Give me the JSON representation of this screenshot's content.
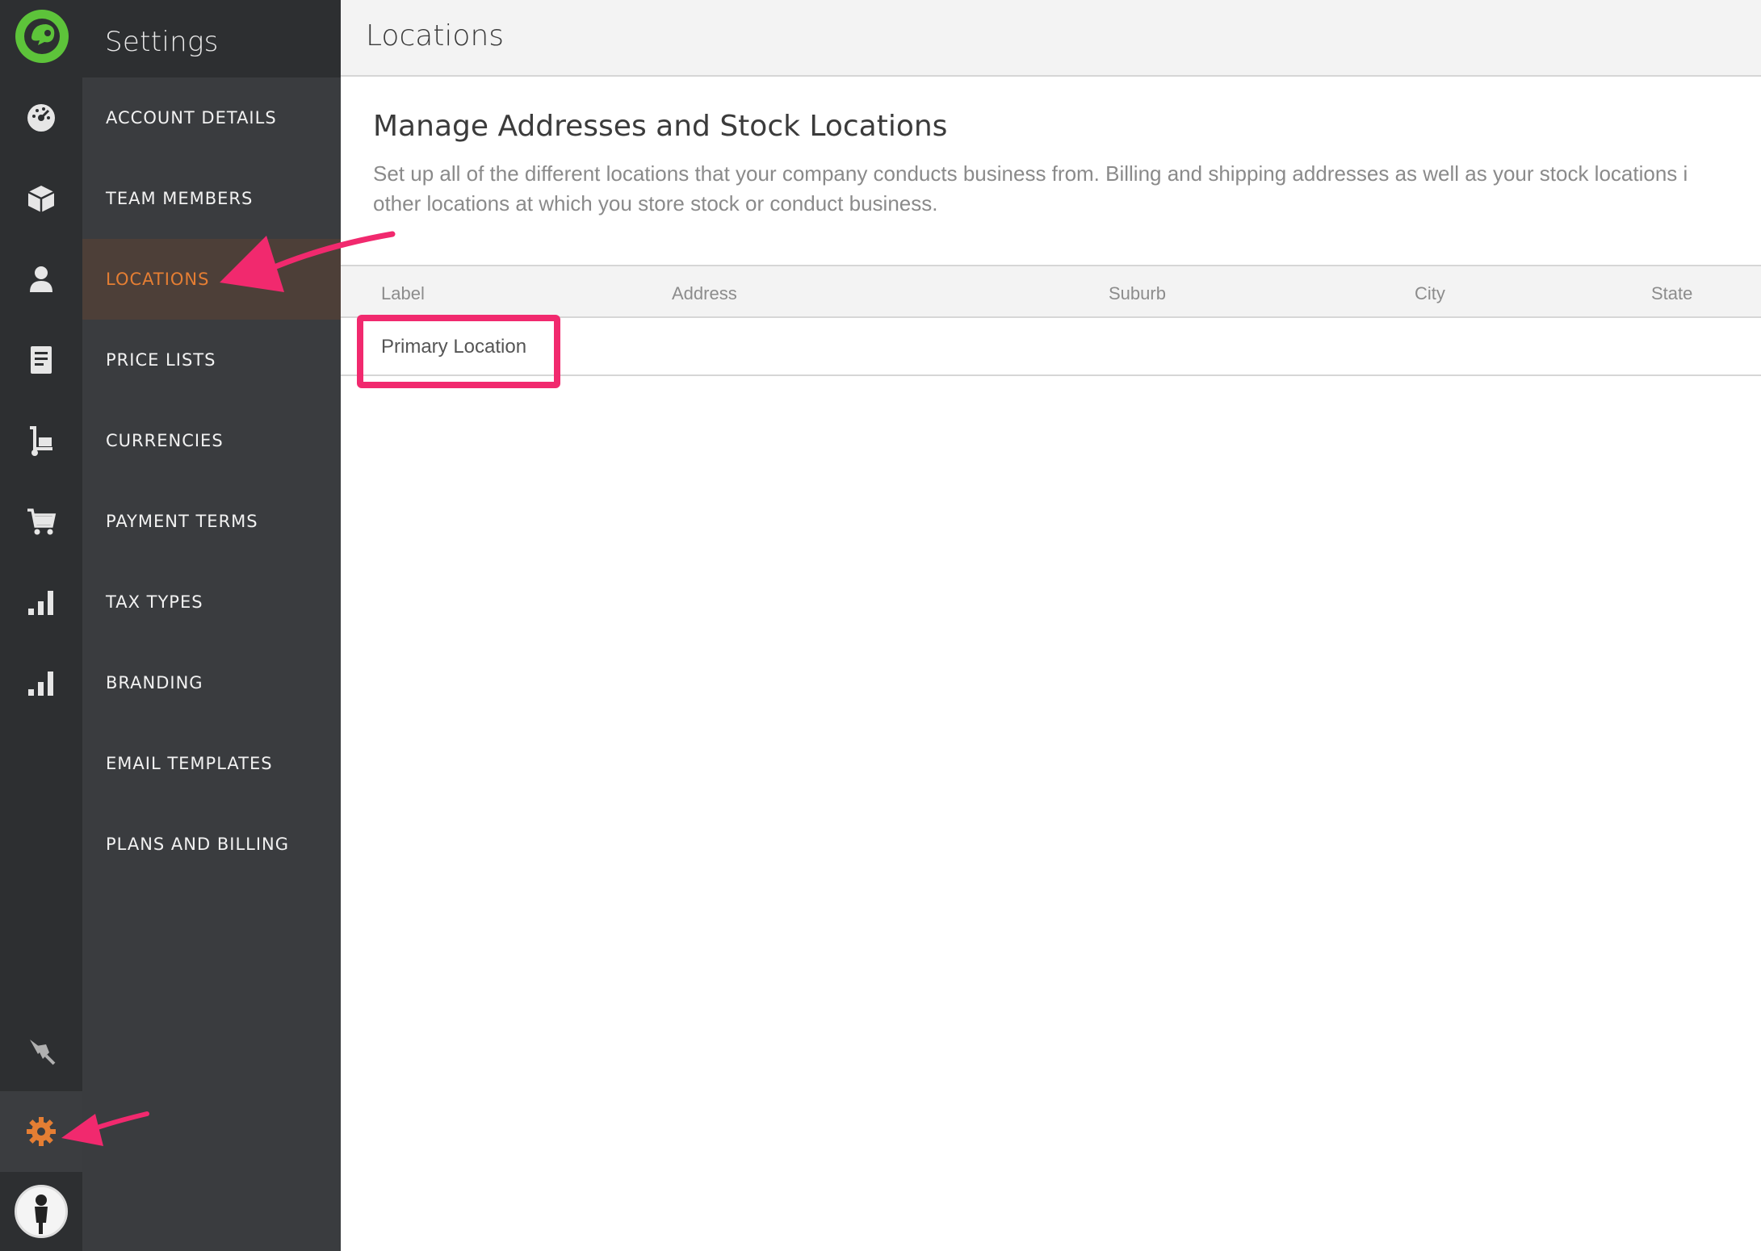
{
  "sidebar": {
    "title": "Settings",
    "items": [
      {
        "label": "ACCOUNT DETAILS",
        "active": false
      },
      {
        "label": "TEAM MEMBERS",
        "active": false
      },
      {
        "label": "LOCATIONS",
        "active": true
      },
      {
        "label": "PRICE LISTS",
        "active": false
      },
      {
        "label": "CURRENCIES",
        "active": false
      },
      {
        "label": "PAYMENT TERMS",
        "active": false
      },
      {
        "label": "TAX TYPES",
        "active": false
      },
      {
        "label": "BRANDING",
        "active": false
      },
      {
        "label": "EMAIL TEMPLATES",
        "active": false
      },
      {
        "label": "PLANS AND BILLING",
        "active": false
      }
    ]
  },
  "rail": {
    "icons": [
      "dashboard-icon",
      "box-icon",
      "person-icon",
      "document-icon",
      "trolley-icon",
      "cart-icon",
      "bar-chart-icon",
      "bar-chart-icon",
      "plug-icon",
      "gear-icon"
    ]
  },
  "main": {
    "page_title": "Locations",
    "section_title": "Manage Addresses and Stock Locations",
    "section_desc_1": "Set up all of the different locations that your company conducts business from. Billing and shipping addresses as well as your stock locations i",
    "section_desc_2": "other locations at which you store stock or conduct business.",
    "table": {
      "columns": [
        "Label",
        "Address",
        "Suburb",
        "City",
        "State"
      ],
      "rows": [
        {
          "label": "Primary Location"
        }
      ]
    }
  },
  "colors": {
    "accent": "#e57e33",
    "annotation": "#f1296e",
    "rail_bg": "#2d2f31",
    "sidebar_bg": "#3a3c3f",
    "logo_green": "#5dc33a"
  }
}
